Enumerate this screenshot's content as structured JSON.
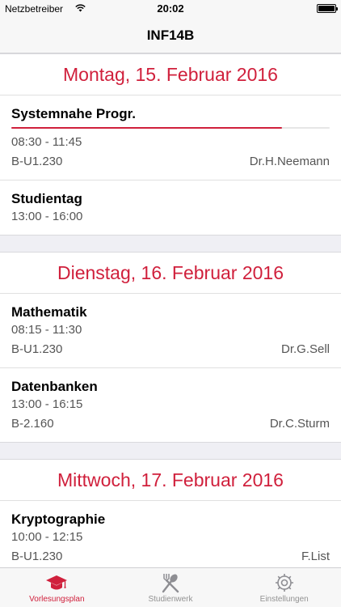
{
  "status_bar": {
    "carrier": "Netzbetreiber",
    "time": "20:02"
  },
  "nav": {
    "title": "INF14B"
  },
  "colors": {
    "accent": "#d0203c"
  },
  "days": [
    {
      "header": "Montag, 15. Februar 2016",
      "lectures": [
        {
          "name": "Systemnahe Progr.",
          "time": "08:30 - 11:45",
          "room": "B-U1.230",
          "lecturer": "Dr.H.Neemann",
          "progress": 0.85
        },
        {
          "name": "Studientag",
          "time": "13:00 - 16:00"
        }
      ]
    },
    {
      "header": "Dienstag, 16. Februar 2016",
      "lectures": [
        {
          "name": "Mathematik",
          "time": "08:15 - 11:30",
          "room": "B-U1.230",
          "lecturer": "Dr.G.Sell"
        },
        {
          "name": "Datenbanken",
          "time": "13:00 - 16:15",
          "room": "B-2.160",
          "lecturer": "Dr.C.Sturm"
        }
      ]
    },
    {
      "header": "Mittwoch, 17. Februar 2016",
      "lectures": [
        {
          "name": "Kryptographie",
          "time": "10:00 - 12:15",
          "room": "B-U1.230",
          "lecturer": "F.List"
        }
      ]
    }
  ],
  "tabs": [
    {
      "label": "Vorlesungsplan",
      "icon": "graduation-cap-icon",
      "active": true
    },
    {
      "label": "Studienwerk",
      "icon": "fork-spoon-icon",
      "active": false
    },
    {
      "label": "Einstellungen",
      "icon": "gear-icon",
      "active": false
    }
  ]
}
